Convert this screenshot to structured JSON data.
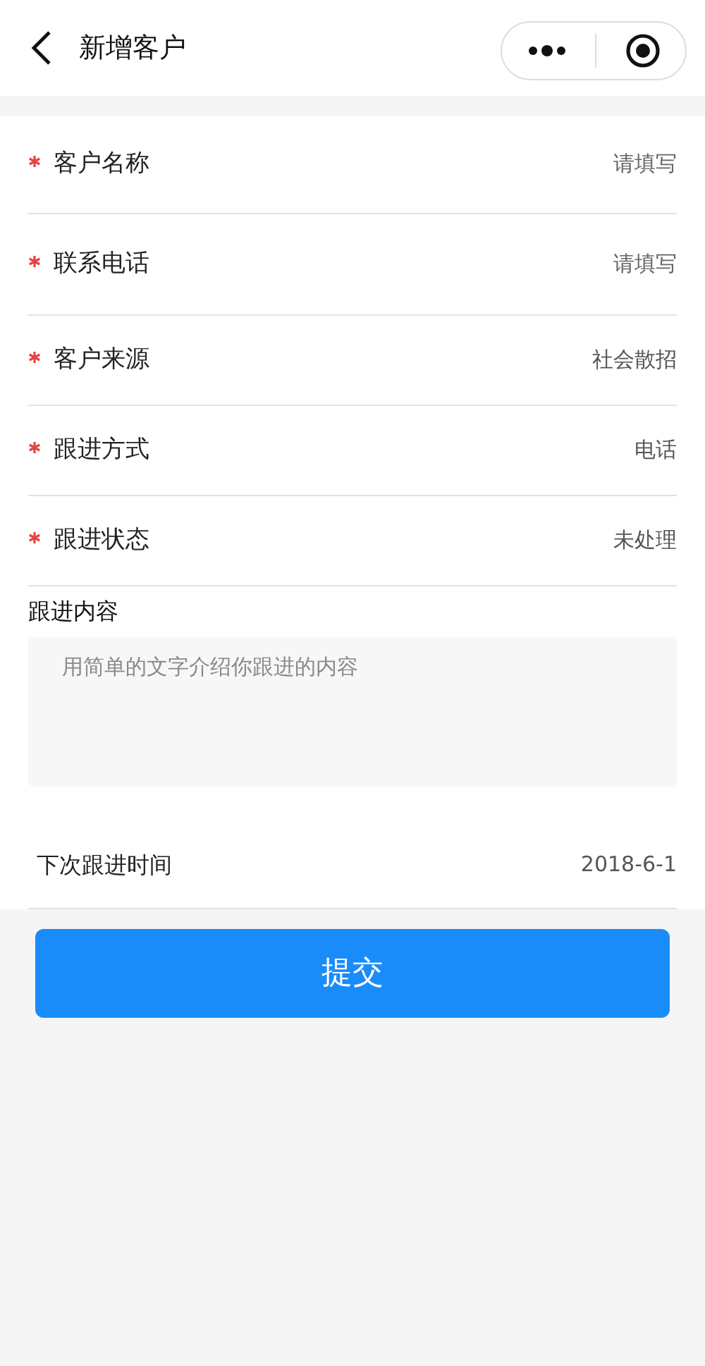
{
  "nav": {
    "title": "新增客户"
  },
  "fields": [
    {
      "label": "客户名称",
      "required": true,
      "kind": "input",
      "placeholder": "请填写"
    },
    {
      "label": "联系电话",
      "required": true,
      "kind": "input",
      "placeholder": "请填写"
    },
    {
      "label": "客户来源",
      "required": true,
      "kind": "select",
      "value": "社会散招"
    },
    {
      "label": "跟进方式",
      "required": true,
      "kind": "select",
      "value": "电话"
    },
    {
      "label": "跟进状态",
      "required": true,
      "kind": "select",
      "value": "未处理"
    }
  ],
  "content": {
    "label": "跟进内容",
    "placeholder": "用简单的文字介绍你跟进的内容"
  },
  "next_time": {
    "label": "下次跟进时间",
    "value": "2018-6-1"
  },
  "submit": "提交"
}
